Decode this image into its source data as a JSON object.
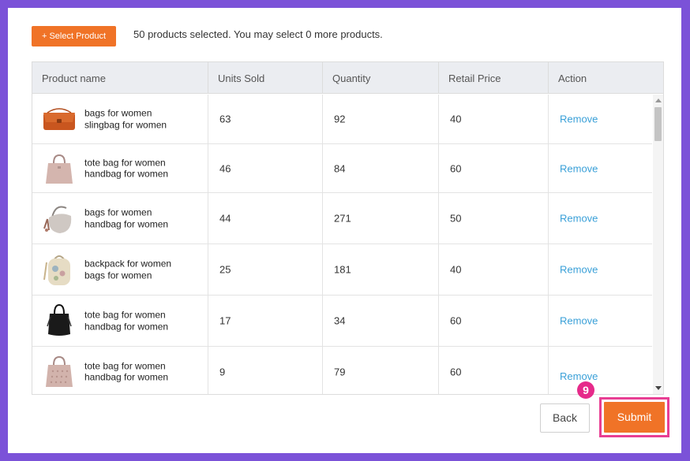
{
  "toolbar": {
    "select_product_label": "+ Select Product",
    "selected_info": "50 products selected. You may select 0 more products."
  },
  "table": {
    "columns": [
      "Product name",
      "Units Sold",
      "Quantity",
      "Retail Price",
      "Action"
    ],
    "rows": [
      {
        "name_line1": "bags for women",
        "name_line2": "slingbag for women",
        "units_sold": "63",
        "quantity": "92",
        "retail_price": "40",
        "action": "Remove",
        "thumb_icon": "orange-slingbag-icon"
      },
      {
        "name_line1": "tote bag for women",
        "name_line2": "handbag for women",
        "units_sold": "46",
        "quantity": "84",
        "retail_price": "60",
        "action": "Remove",
        "thumb_icon": "pink-tote-bag-icon"
      },
      {
        "name_line1": "bags for women",
        "name_line2": "handbag for women",
        "units_sold": "44",
        "quantity": "271",
        "retail_price": "50",
        "action": "Remove",
        "thumb_icon": "grey-hobo-bag-icon"
      },
      {
        "name_line1": "backpack for women",
        "name_line2": "bags for women",
        "units_sold": "25",
        "quantity": "181",
        "retail_price": "40",
        "action": "Remove",
        "thumb_icon": "floral-backpack-icon"
      },
      {
        "name_line1": "tote bag for women",
        "name_line2": "handbag for women",
        "units_sold": "17",
        "quantity": "34",
        "retail_price": "60",
        "action": "Remove",
        "thumb_icon": "black-bucket-bag-icon"
      },
      {
        "name_line1": "tote bag for women",
        "name_line2": "handbag for women",
        "units_sold": "9",
        "quantity": "79",
        "retail_price": "60",
        "action": "Remove",
        "thumb_icon": "pink-perforated-tote-icon"
      }
    ]
  },
  "footer": {
    "back_label": "Back",
    "submit_label": "Submit",
    "step_badge": "9"
  },
  "colors": {
    "background": "#7b52d8",
    "accent": "#f07327",
    "link": "#3aa0d8",
    "highlight": "#e83e93"
  }
}
